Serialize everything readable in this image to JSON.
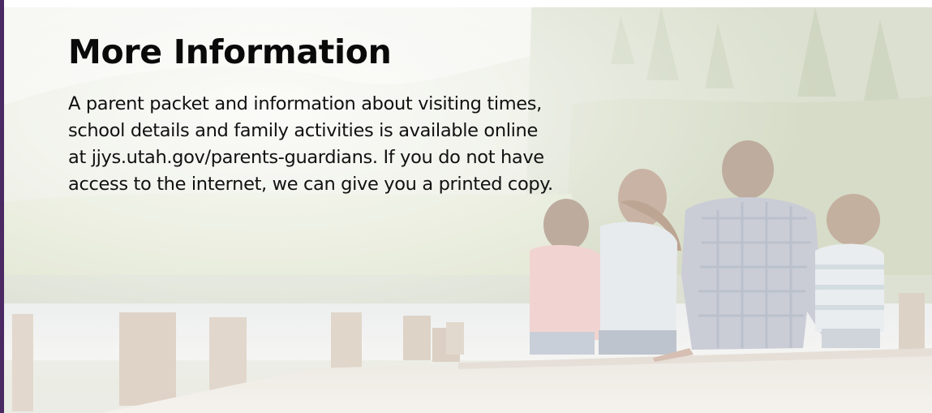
{
  "section": {
    "heading": "More Information",
    "body_lines": [
      "A parent packet and information about visiting times,",
      "school details and family activities is available online",
      "at jjys.utah.gov/parents-guardians.  If you do not have",
      "access to the internet, we can give you a printed copy."
    ]
  },
  "colors": {
    "accent": "#4b2a63",
    "text": "#111111"
  }
}
